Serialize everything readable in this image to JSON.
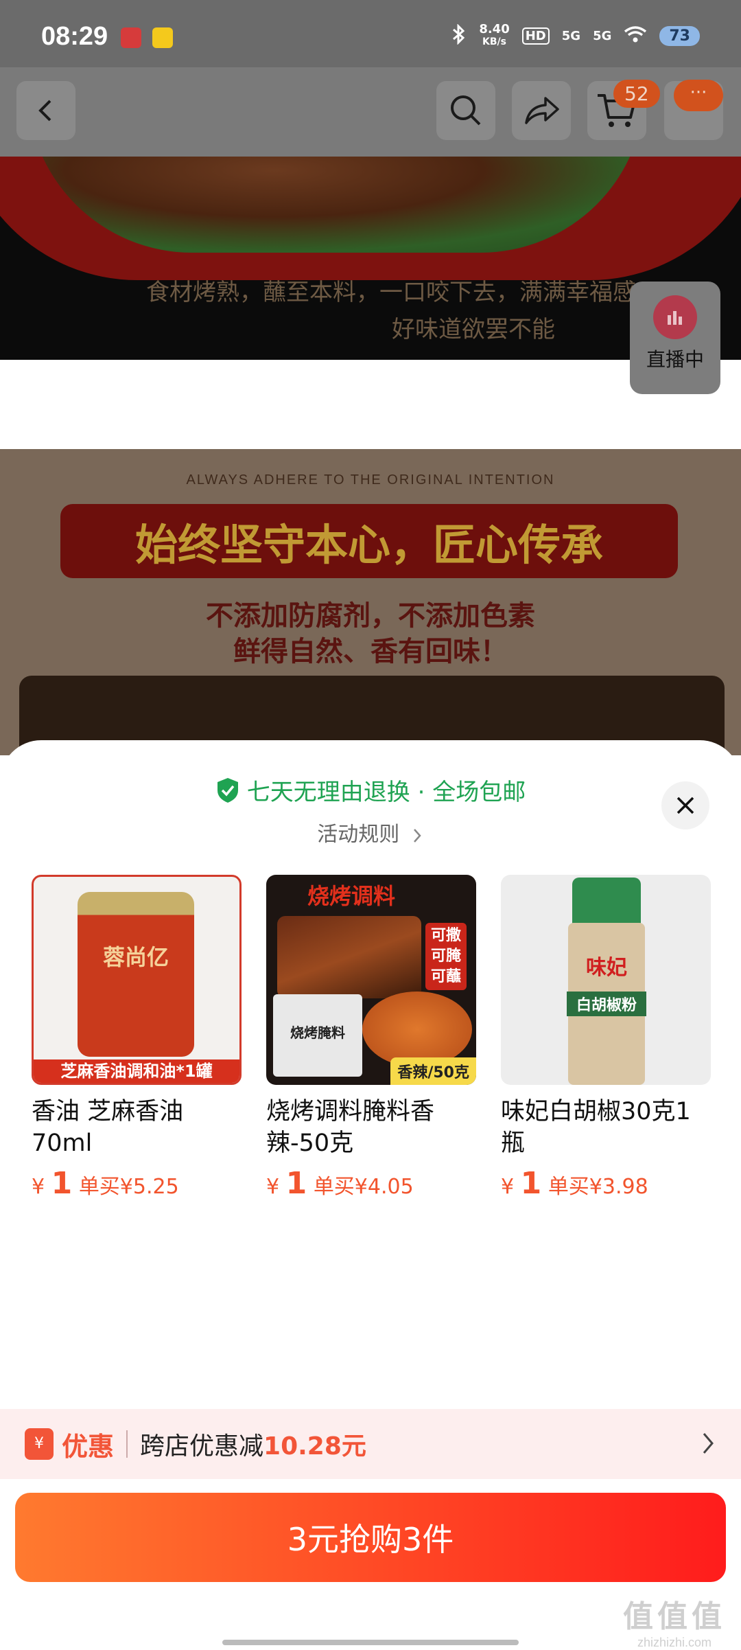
{
  "status_bar": {
    "time": "08:29",
    "net_speed_value": "8.40",
    "net_speed_unit": "KB/s",
    "hd": "HD",
    "signal1": "5G",
    "signal2": "5G",
    "battery": "73"
  },
  "nav": {
    "cart_count": "52",
    "more_label": "···"
  },
  "detail": {
    "caption_line1": "食材烤熟，蘸至本料，一口咬下去，满满幸福感",
    "caption_line2": "好味道欲罢不能",
    "adhere": "ALWAYS ADHERE TO THE ORIGINAL INTENTION",
    "ribbon": "始终坚守本心，匠心传承",
    "sub1": "不添加防腐剂，不添加色素",
    "sub2": "鲜得自然、香有回味！",
    "live_label": "直播中"
  },
  "sheet": {
    "promo": "七天无理由退换 · 全场包邮",
    "rules": "活动规则",
    "products": [
      {
        "name": "香油 芝麻香油70ml",
        "currency": "¥",
        "price": "1",
        "single": "单买¥5.25",
        "img_brand": "蓉尚亿",
        "img_strip": "芝麻香油调和油*1罐"
      },
      {
        "name": "烧烤调料腌料香辣-50克",
        "currency": "¥",
        "price": "1",
        "single": "单买¥4.05",
        "img_title": "烧烤调料",
        "img_tag": "可撒可腌可蘸",
        "img_pack": "烧烤腌料",
        "img_badge": "香辣/50克"
      },
      {
        "name": "味妃白胡椒30克1瓶",
        "currency": "¥",
        "price": "1",
        "single": "单买¥3.98",
        "img_brand": "味妃",
        "img_label": "白胡椒粉"
      }
    ],
    "discount": {
      "icon": "¥",
      "label": "优惠",
      "text": "跨店优惠减",
      "amount": "10.28元"
    },
    "buy_button": "3元抢购3件"
  },
  "watermark": {
    "line1": "值值值",
    "line2": "zhizhizhi.com"
  },
  "colors": {
    "accent": "#f25538",
    "green": "#1fa352"
  }
}
